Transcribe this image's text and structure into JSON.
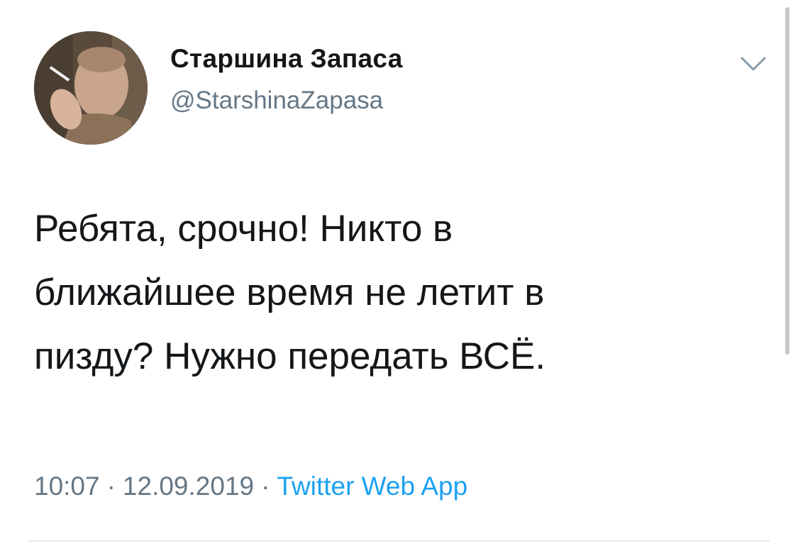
{
  "author": {
    "display_name": "Старшина Запаса",
    "handle": "@StarshinaZapasa",
    "avatar_icon": "profile-photo"
  },
  "tweet": {
    "lines": [
      "Ребята, срочно! Никто в",
      "ближайшее время не летит в",
      "пизду? Нужно передать ВСЁ."
    ]
  },
  "meta": {
    "time": "10:07",
    "separator": "·",
    "date": "12.09.2019",
    "source": "Twitter Web App"
  },
  "menu": {
    "icon": "chevron-down-icon"
  },
  "colors": {
    "text": "#14171a",
    "secondary": "#657786",
    "link": "#1da1f2",
    "divider": "#e1e8ed"
  }
}
